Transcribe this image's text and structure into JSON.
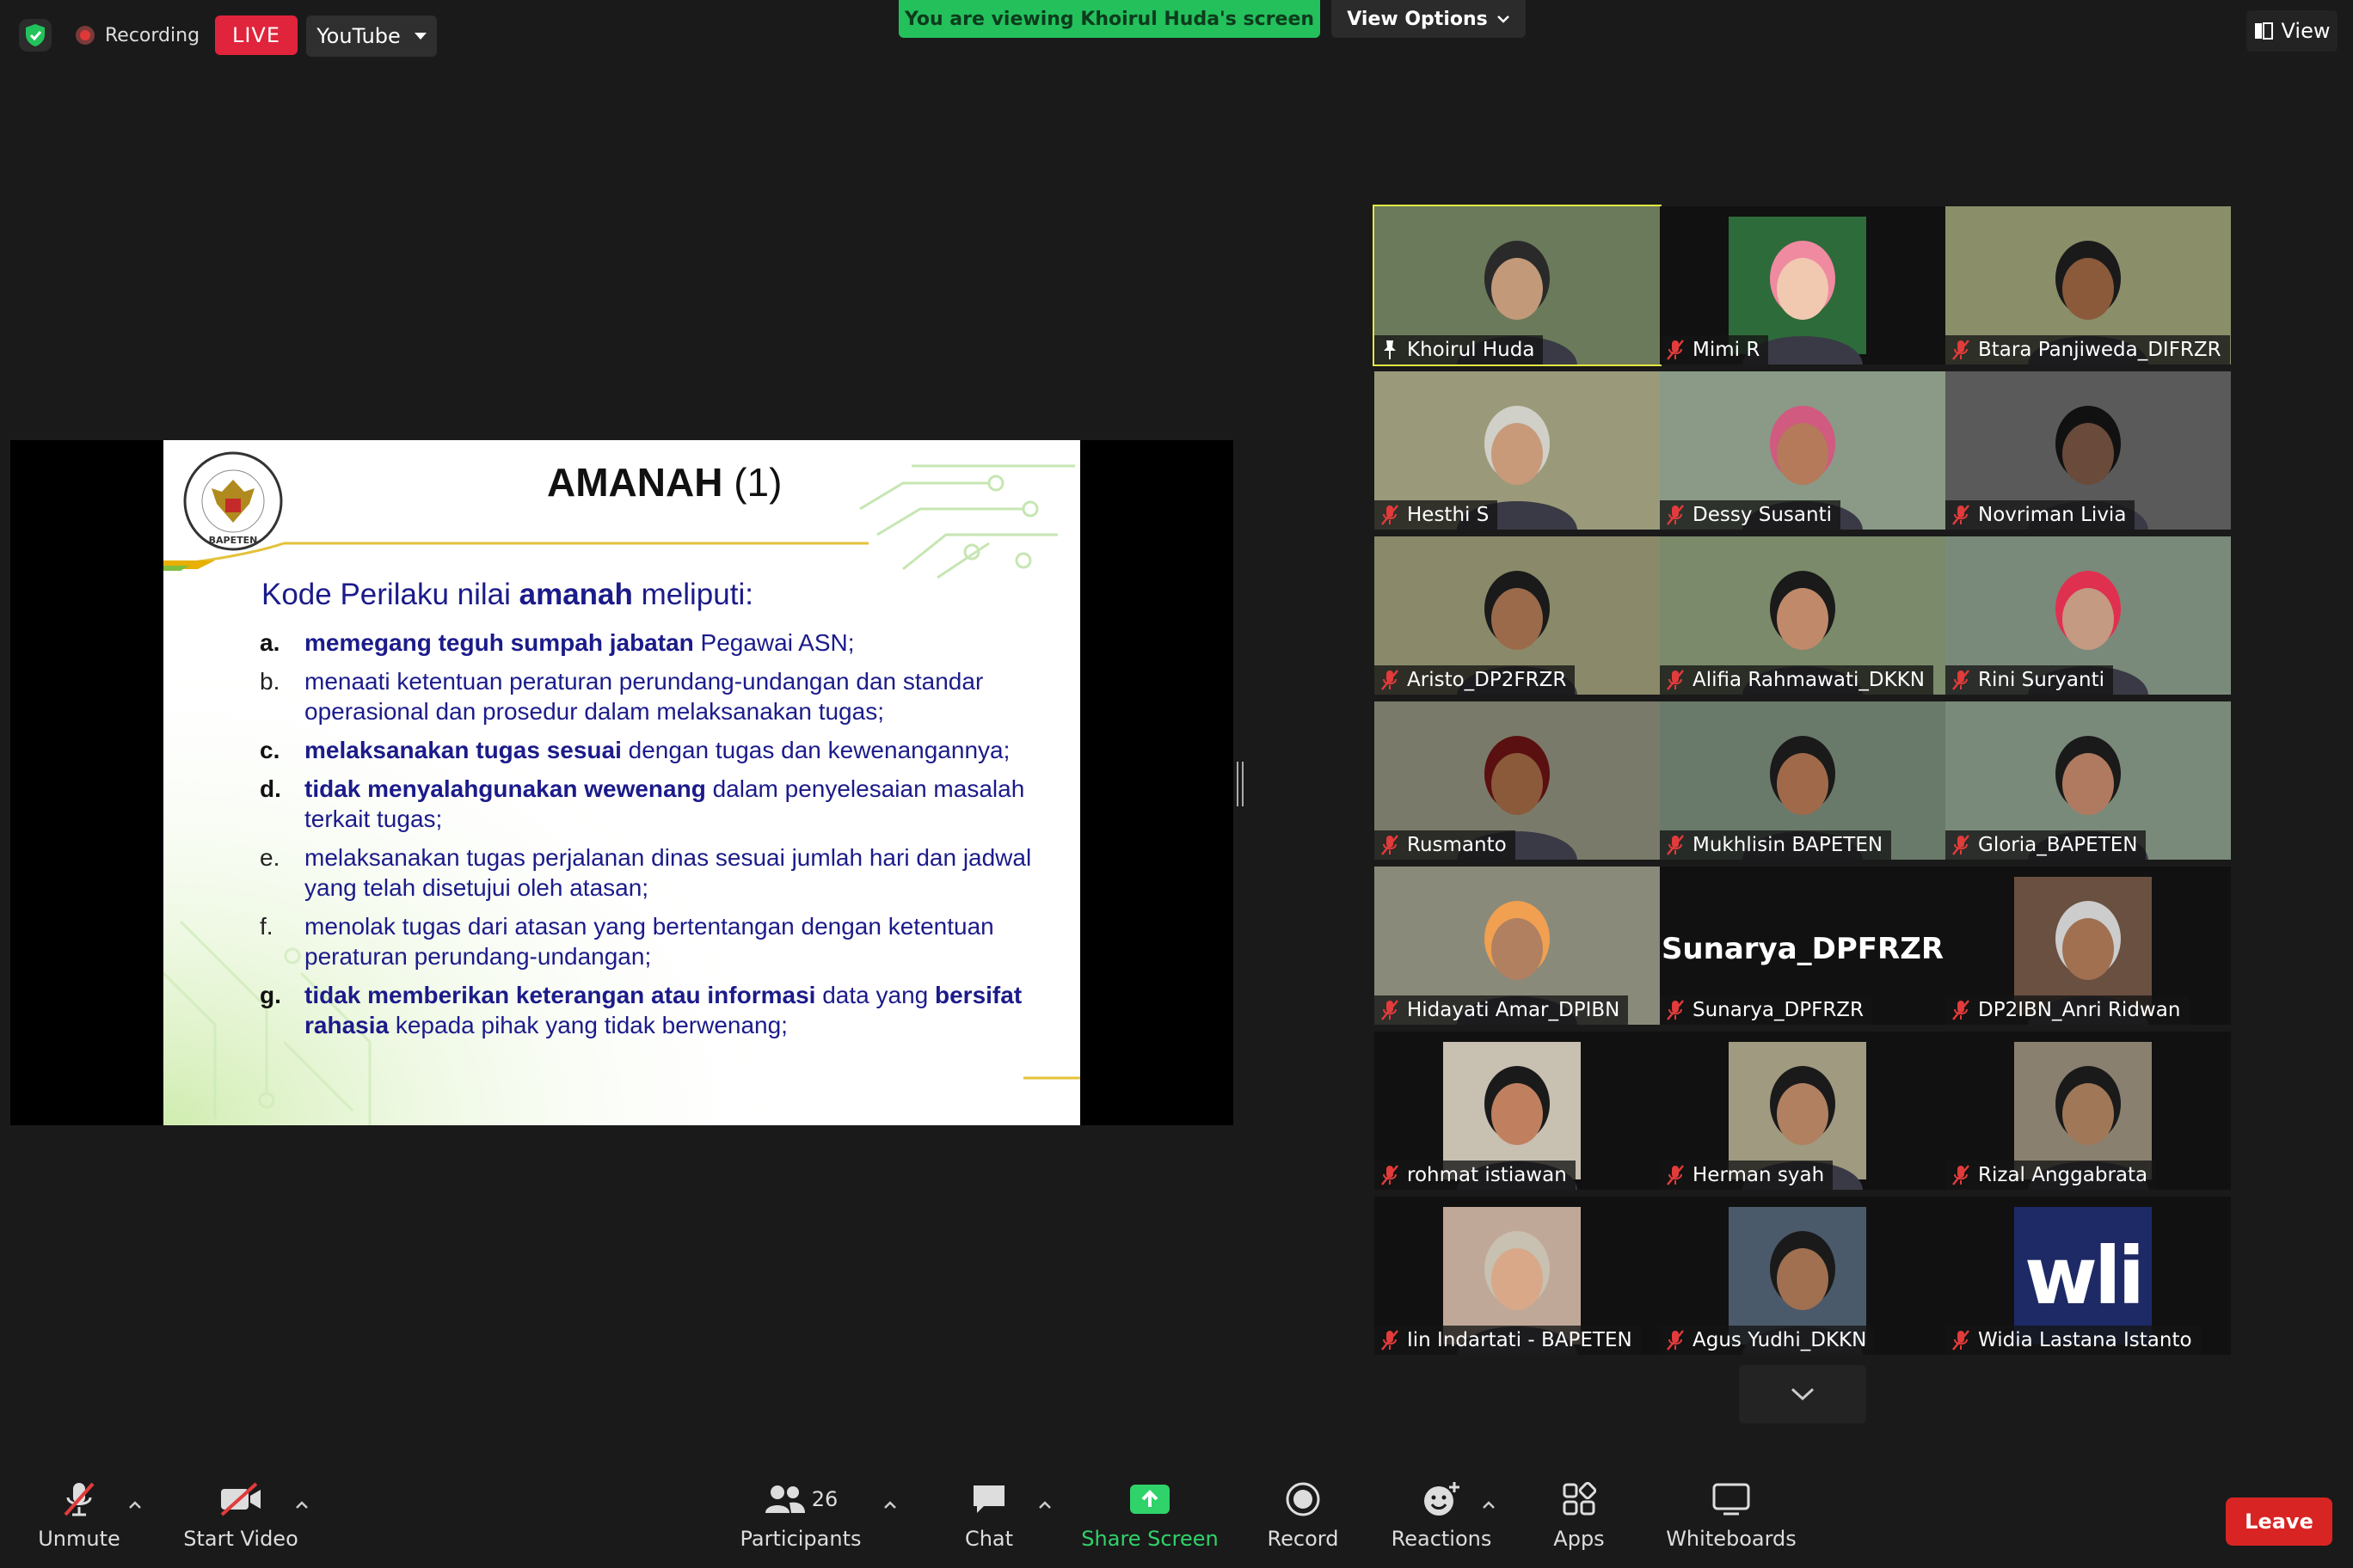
{
  "topbar": {
    "recording_label": "Recording",
    "live_label": "LIVE",
    "stream_target": "YouTube",
    "viewing_banner": "You are viewing Khoirul Huda's screen",
    "view_options_label": "View Options",
    "view_label": "View"
  },
  "slide": {
    "title": "AMANAH",
    "title_suffix": "(1)",
    "intro_prefix": "Kode Perilaku nilai ",
    "intro_bold": "amanah",
    "intro_suffix": " meliputi:",
    "items": [
      {
        "letter": "a.",
        "bold": "memegang teguh sumpah jabatan",
        "text": " Pegawai ASN;"
      },
      {
        "letter": "b.",
        "bold": "",
        "text": "menaati ketentuan peraturan perundang-undangan dan standar operasional dan prosedur dalam melaksanakan tugas;"
      },
      {
        "letter": "c.",
        "bold": "melaksanakan tugas sesuai",
        "text": " dengan tugas dan kewenangannya;"
      },
      {
        "letter": "d.",
        "bold": "tidak menyalahgunakan wewenang",
        "text": " dalam penyelesaian masalah terkait tugas;"
      },
      {
        "letter": "e.",
        "bold": "",
        "text": "melaksanakan tugas perjalanan dinas sesuai jumlah hari dan jadwal yang telah disetujui oleh atasan;"
      },
      {
        "letter": "f.",
        "bold": "",
        "text": "menolak tugas dari atasan yang bertentangan dengan ketentuan peraturan perundang-undangan;"
      },
      {
        "letter": "g.",
        "bold": "tidak memberikan keterangan atau informasi",
        "text": " data yang ",
        "bold2": "bersifat rahasia",
        "text2": " kepada pihak yang tidak berwenang;"
      }
    ]
  },
  "participants": [
    {
      "name": "Khoirul Huda",
      "speaking": true,
      "pinned": true
    },
    {
      "name": "Mimi R"
    },
    {
      "name": "Btara Panjiweda_DIFRZR"
    },
    {
      "name": "Hesthi S"
    },
    {
      "name": "Dessy Susanti"
    },
    {
      "name": "Novriman Livia"
    },
    {
      "name": "Aristo_DP2FRZR"
    },
    {
      "name": "Alifia Rahmawati_DKKN"
    },
    {
      "name": "Rini Suryanti"
    },
    {
      "name": "Rusmanto"
    },
    {
      "name": "Mukhlisin BAPETEN"
    },
    {
      "name": "Gloria_BAPETEN"
    },
    {
      "name": "Hidayati Amar_DPIBN"
    },
    {
      "name": "Sunarya_DPFRZR",
      "video_off": true,
      "display_name": "Sunarya_DPFRZR"
    },
    {
      "name": "DP2IBN_Anri Ridwan"
    },
    {
      "name": "rohmat istiawan"
    },
    {
      "name": "Herman syah"
    },
    {
      "name": "Rizal Anggabrata"
    },
    {
      "name": "Iin Indartati - BAPETEN"
    },
    {
      "name": "Agus Yudhi_DKKN"
    },
    {
      "name": "Widia Lastana Istanto",
      "logo_text": "wli"
    }
  ],
  "toolbar": {
    "unmute": "Unmute",
    "start_video": "Start Video",
    "participants": "Participants",
    "participant_count": "26",
    "chat": "Chat",
    "share_screen": "Share Screen",
    "record": "Record",
    "reactions": "Reactions",
    "apps": "Apps",
    "whiteboards": "Whiteboards",
    "leave": "Leave"
  },
  "colors": {
    "banner_green": "#23c05c",
    "live_red": "#e0243b",
    "leave_red": "#d92424",
    "speaker_outline": "#e5e843",
    "slide_text": "#1b1b8a"
  }
}
